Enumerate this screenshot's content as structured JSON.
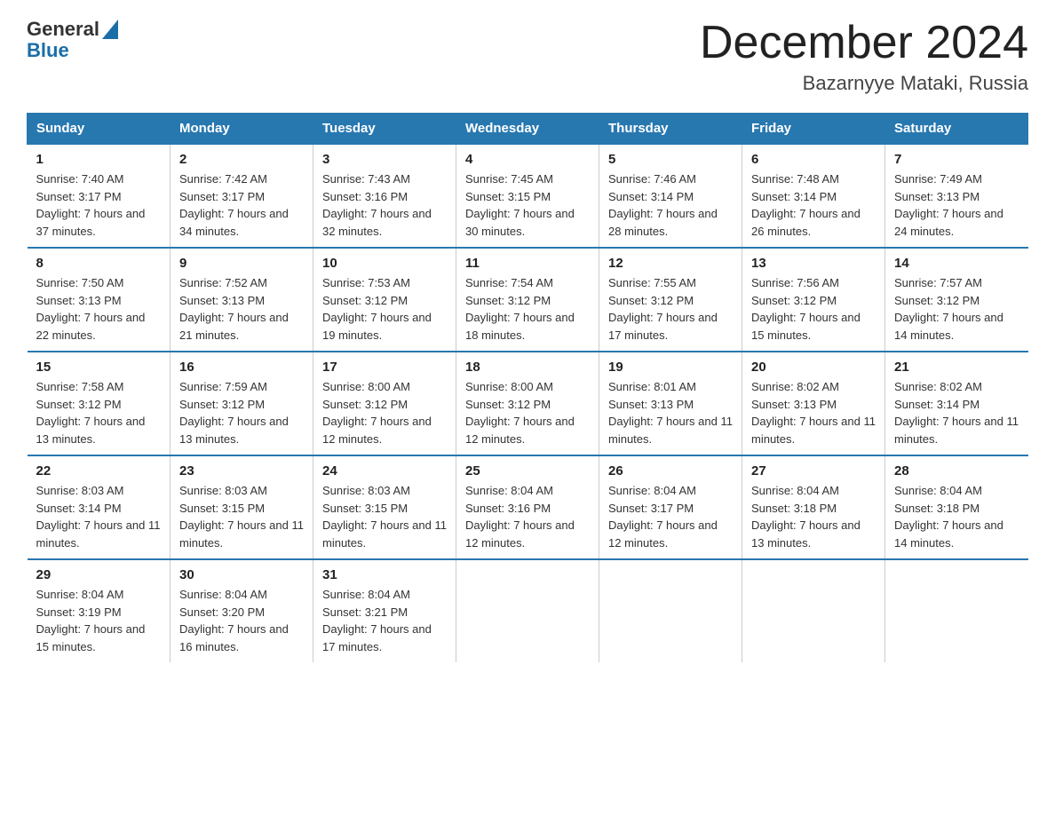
{
  "header": {
    "logo_general": "General",
    "logo_blue": "Blue",
    "title": "December 2024",
    "subtitle": "Bazarnyye Mataki, Russia"
  },
  "calendar": {
    "days_of_week": [
      "Sunday",
      "Monday",
      "Tuesday",
      "Wednesday",
      "Thursday",
      "Friday",
      "Saturday"
    ],
    "weeks": [
      [
        {
          "day": "1",
          "sunrise": "Sunrise: 7:40 AM",
          "sunset": "Sunset: 3:17 PM",
          "daylight": "Daylight: 7 hours and 37 minutes."
        },
        {
          "day": "2",
          "sunrise": "Sunrise: 7:42 AM",
          "sunset": "Sunset: 3:17 PM",
          "daylight": "Daylight: 7 hours and 34 minutes."
        },
        {
          "day": "3",
          "sunrise": "Sunrise: 7:43 AM",
          "sunset": "Sunset: 3:16 PM",
          "daylight": "Daylight: 7 hours and 32 minutes."
        },
        {
          "day": "4",
          "sunrise": "Sunrise: 7:45 AM",
          "sunset": "Sunset: 3:15 PM",
          "daylight": "Daylight: 7 hours and 30 minutes."
        },
        {
          "day": "5",
          "sunrise": "Sunrise: 7:46 AM",
          "sunset": "Sunset: 3:14 PM",
          "daylight": "Daylight: 7 hours and 28 minutes."
        },
        {
          "day": "6",
          "sunrise": "Sunrise: 7:48 AM",
          "sunset": "Sunset: 3:14 PM",
          "daylight": "Daylight: 7 hours and 26 minutes."
        },
        {
          "day": "7",
          "sunrise": "Sunrise: 7:49 AM",
          "sunset": "Sunset: 3:13 PM",
          "daylight": "Daylight: 7 hours and 24 minutes."
        }
      ],
      [
        {
          "day": "8",
          "sunrise": "Sunrise: 7:50 AM",
          "sunset": "Sunset: 3:13 PM",
          "daylight": "Daylight: 7 hours and 22 minutes."
        },
        {
          "day": "9",
          "sunrise": "Sunrise: 7:52 AM",
          "sunset": "Sunset: 3:13 PM",
          "daylight": "Daylight: 7 hours and 21 minutes."
        },
        {
          "day": "10",
          "sunrise": "Sunrise: 7:53 AM",
          "sunset": "Sunset: 3:12 PM",
          "daylight": "Daylight: 7 hours and 19 minutes."
        },
        {
          "day": "11",
          "sunrise": "Sunrise: 7:54 AM",
          "sunset": "Sunset: 3:12 PM",
          "daylight": "Daylight: 7 hours and 18 minutes."
        },
        {
          "day": "12",
          "sunrise": "Sunrise: 7:55 AM",
          "sunset": "Sunset: 3:12 PM",
          "daylight": "Daylight: 7 hours and 17 minutes."
        },
        {
          "day": "13",
          "sunrise": "Sunrise: 7:56 AM",
          "sunset": "Sunset: 3:12 PM",
          "daylight": "Daylight: 7 hours and 15 minutes."
        },
        {
          "day": "14",
          "sunrise": "Sunrise: 7:57 AM",
          "sunset": "Sunset: 3:12 PM",
          "daylight": "Daylight: 7 hours and 14 minutes."
        }
      ],
      [
        {
          "day": "15",
          "sunrise": "Sunrise: 7:58 AM",
          "sunset": "Sunset: 3:12 PM",
          "daylight": "Daylight: 7 hours and 13 minutes."
        },
        {
          "day": "16",
          "sunrise": "Sunrise: 7:59 AM",
          "sunset": "Sunset: 3:12 PM",
          "daylight": "Daylight: 7 hours and 13 minutes."
        },
        {
          "day": "17",
          "sunrise": "Sunrise: 8:00 AM",
          "sunset": "Sunset: 3:12 PM",
          "daylight": "Daylight: 7 hours and 12 minutes."
        },
        {
          "day": "18",
          "sunrise": "Sunrise: 8:00 AM",
          "sunset": "Sunset: 3:12 PM",
          "daylight": "Daylight: 7 hours and 12 minutes."
        },
        {
          "day": "19",
          "sunrise": "Sunrise: 8:01 AM",
          "sunset": "Sunset: 3:13 PM",
          "daylight": "Daylight: 7 hours and 11 minutes."
        },
        {
          "day": "20",
          "sunrise": "Sunrise: 8:02 AM",
          "sunset": "Sunset: 3:13 PM",
          "daylight": "Daylight: 7 hours and 11 minutes."
        },
        {
          "day": "21",
          "sunrise": "Sunrise: 8:02 AM",
          "sunset": "Sunset: 3:14 PM",
          "daylight": "Daylight: 7 hours and 11 minutes."
        }
      ],
      [
        {
          "day": "22",
          "sunrise": "Sunrise: 8:03 AM",
          "sunset": "Sunset: 3:14 PM",
          "daylight": "Daylight: 7 hours and 11 minutes."
        },
        {
          "day": "23",
          "sunrise": "Sunrise: 8:03 AM",
          "sunset": "Sunset: 3:15 PM",
          "daylight": "Daylight: 7 hours and 11 minutes."
        },
        {
          "day": "24",
          "sunrise": "Sunrise: 8:03 AM",
          "sunset": "Sunset: 3:15 PM",
          "daylight": "Daylight: 7 hours and 11 minutes."
        },
        {
          "day": "25",
          "sunrise": "Sunrise: 8:04 AM",
          "sunset": "Sunset: 3:16 PM",
          "daylight": "Daylight: 7 hours and 12 minutes."
        },
        {
          "day": "26",
          "sunrise": "Sunrise: 8:04 AM",
          "sunset": "Sunset: 3:17 PM",
          "daylight": "Daylight: 7 hours and 12 minutes."
        },
        {
          "day": "27",
          "sunrise": "Sunrise: 8:04 AM",
          "sunset": "Sunset: 3:18 PM",
          "daylight": "Daylight: 7 hours and 13 minutes."
        },
        {
          "day": "28",
          "sunrise": "Sunrise: 8:04 AM",
          "sunset": "Sunset: 3:18 PM",
          "daylight": "Daylight: 7 hours and 14 minutes."
        }
      ],
      [
        {
          "day": "29",
          "sunrise": "Sunrise: 8:04 AM",
          "sunset": "Sunset: 3:19 PM",
          "daylight": "Daylight: 7 hours and 15 minutes."
        },
        {
          "day": "30",
          "sunrise": "Sunrise: 8:04 AM",
          "sunset": "Sunset: 3:20 PM",
          "daylight": "Daylight: 7 hours and 16 minutes."
        },
        {
          "day": "31",
          "sunrise": "Sunrise: 8:04 AM",
          "sunset": "Sunset: 3:21 PM",
          "daylight": "Daylight: 7 hours and 17 minutes."
        },
        null,
        null,
        null,
        null
      ]
    ]
  }
}
